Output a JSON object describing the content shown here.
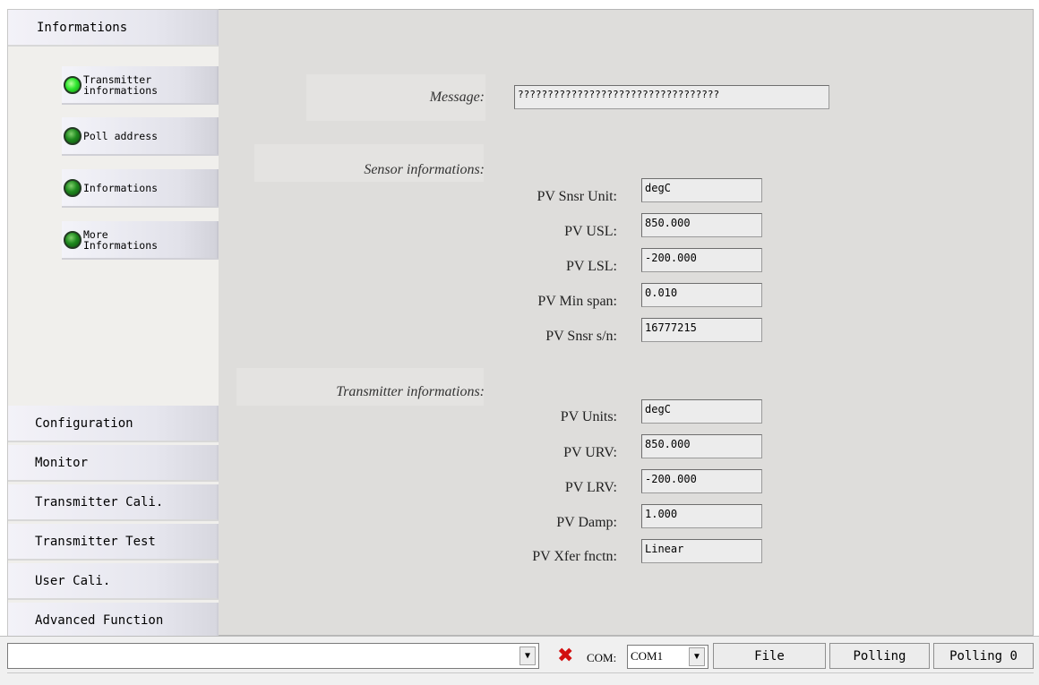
{
  "sidebar": {
    "top_button": "Informations",
    "sub_items": [
      {
        "label": "Transmitter\ninformations",
        "led": "bright"
      },
      {
        "label": "Poll address",
        "led": "dark"
      },
      {
        "label": "Informations",
        "led": "dark"
      },
      {
        "label": "More\nInformations",
        "led": "dark"
      }
    ],
    "bottom_buttons": [
      "Configuration",
      "Monitor",
      "Transmitter Cali.",
      "Transmitter Test",
      "User Cali.",
      "Advanced Function"
    ]
  },
  "main": {
    "message_label": "Message:",
    "message_value": "??????????????????????????????????",
    "sensor_heading": "Sensor informations:",
    "sensor_fields": [
      {
        "label": "PV Snsr Unit:",
        "value": "degC"
      },
      {
        "label": "PV USL:",
        "value": "850.000"
      },
      {
        "label": "PV LSL:",
        "value": "-200.000"
      },
      {
        "label": "PV Min span:",
        "value": "0.010"
      },
      {
        "label": "PV Snsr s/n:",
        "value": "16777215"
      }
    ],
    "transmitter_heading": "Transmitter informations:",
    "transmitter_fields": [
      {
        "label": "PV Units:",
        "value": "degC"
      },
      {
        "label": "PV URV:",
        "value": "850.000"
      },
      {
        "label": "PV LRV:",
        "value": "-200.000"
      },
      {
        "label": "PV Damp:",
        "value": "1.000"
      },
      {
        "label": "PV Xfer fnctn:",
        "value": "Linear"
      }
    ]
  },
  "statusbar": {
    "command_value": "",
    "com_label": "COM:",
    "com_value": "COM1",
    "file_button": "File",
    "polling_button": "Polling",
    "polling_count": "Polling 0",
    "disconnect_icon": "red-x-icon"
  }
}
